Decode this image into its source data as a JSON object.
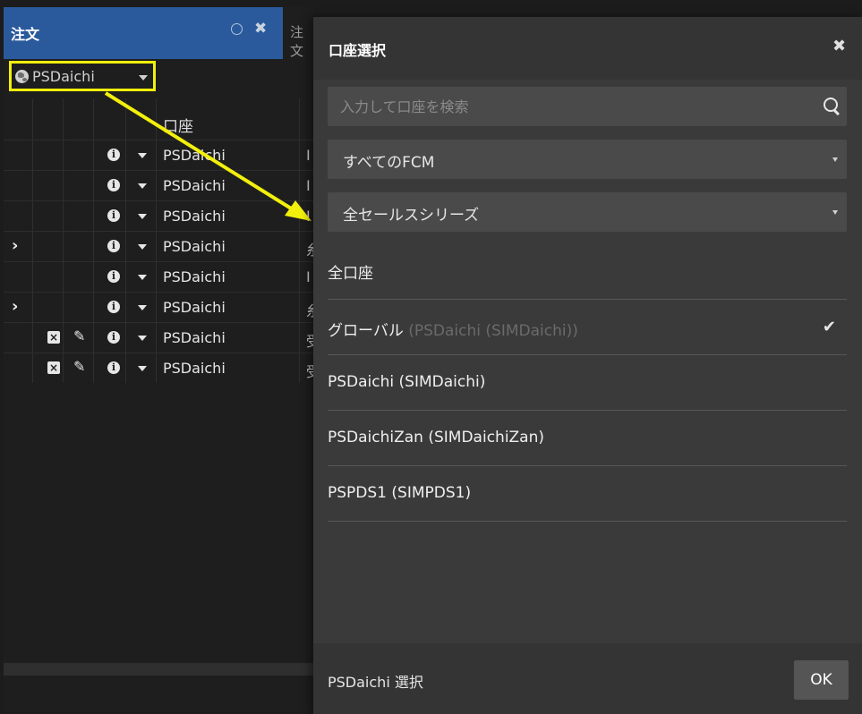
{
  "order_panel": {
    "tab_title": "注文",
    "next_tab_title": "注文",
    "account_selector_label": "PSDaichi",
    "columns": {
      "account": "口座"
    },
    "rows": [
      {
        "expand": false,
        "edit_controls": false,
        "account": "PSDaichi",
        "more": "I"
      },
      {
        "expand": false,
        "edit_controls": false,
        "account": "PSDaichi",
        "more": "I"
      },
      {
        "expand": false,
        "edit_controls": false,
        "account": "PSDaichi",
        "more": "I"
      },
      {
        "expand": true,
        "edit_controls": false,
        "account": "PSDaichi",
        "more": "糸"
      },
      {
        "expand": false,
        "edit_controls": false,
        "account": "PSDaichi",
        "more": "I"
      },
      {
        "expand": true,
        "edit_controls": false,
        "account": "PSDaichi",
        "more": "糸"
      },
      {
        "expand": false,
        "edit_controls": true,
        "account": "PSDaichi",
        "more": "受"
      },
      {
        "expand": false,
        "edit_controls": true,
        "account": "PSDaichi",
        "more": "受"
      }
    ]
  },
  "modal": {
    "title": "口座選択",
    "search": {
      "placeholder": "入力して口座を検索",
      "value": ""
    },
    "fcm_select": {
      "value": "すべてのFCM"
    },
    "sales_series_select": {
      "value": "全セールスシリーズ"
    },
    "accounts": [
      {
        "label": "全口座",
        "sub": "",
        "selected": false
      },
      {
        "label": "グローバル",
        "sub": "(PSDaichi (SIMDaichi))",
        "selected": true
      },
      {
        "label": "PSDaichi (SIMDaichi)",
        "sub": "",
        "selected": false
      },
      {
        "label": "PSDaichiZan (SIMDaichiZan)",
        "sub": "",
        "selected": false
      },
      {
        "label": "PSPDS1 (SIMPDS1)",
        "sub": "",
        "selected": false
      }
    ],
    "footer_label": "PSDaichi 選択",
    "ok_label": "OK"
  },
  "colors": {
    "active_tab": "#2a5a9c",
    "highlight_box": "#f2f00c",
    "arrow": "#f2f00c",
    "modal_bg": "#3a3a3a"
  }
}
